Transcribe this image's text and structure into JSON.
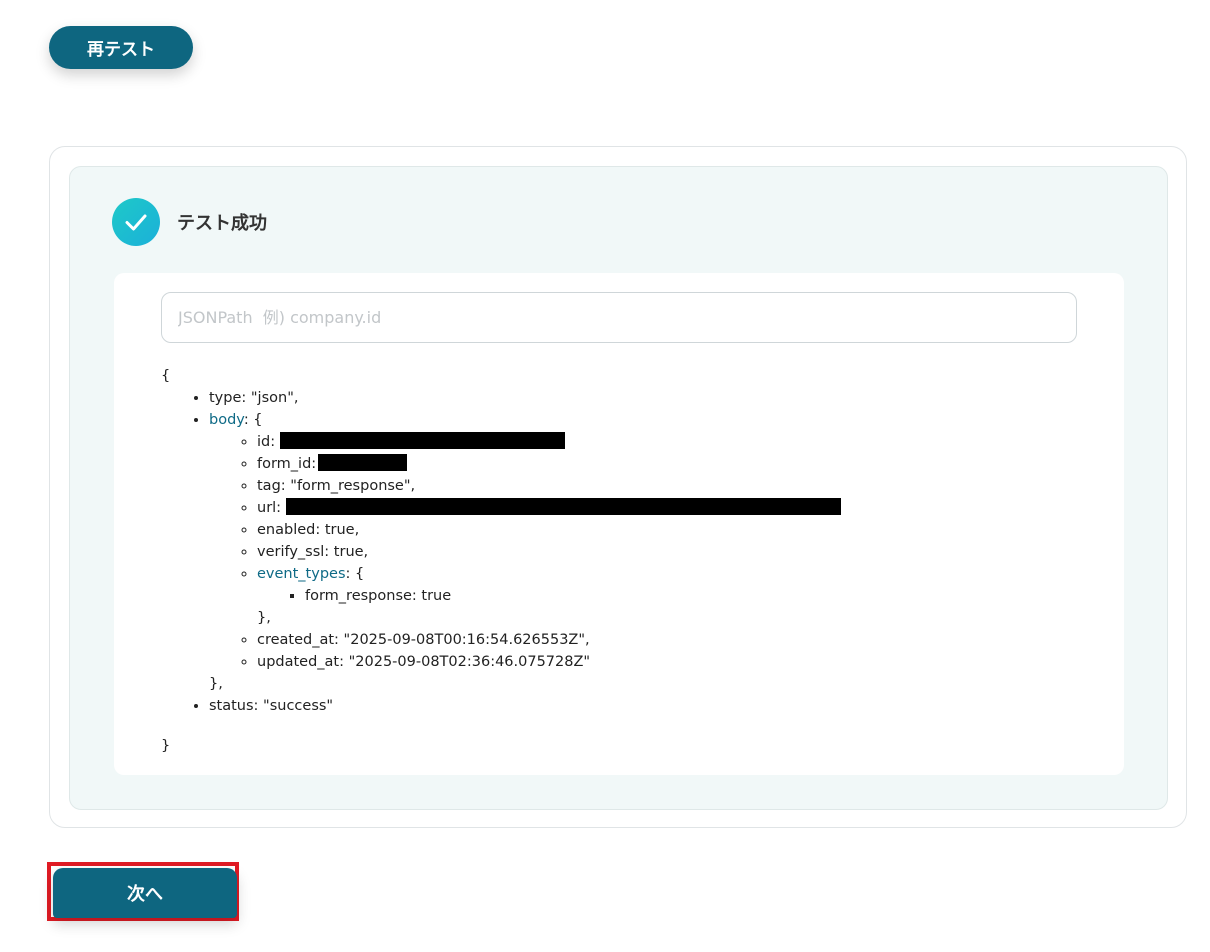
{
  "toolbar": {
    "retest_label": "再テスト"
  },
  "result": {
    "status_title": "テスト成功",
    "jsonpath_placeholder": "JSONPath  例) company.id",
    "json": {
      "open_brace": "{",
      "type_line": "type: \"json\",",
      "body_key": "body",
      "body_open": ": {",
      "id_label": "id:",
      "form_id_label": "form_id:",
      "tag_line": "tag: \"form_response\",",
      "url_label": "url:",
      "enabled_line": "enabled: true,",
      "verify_ssl_line": "verify_ssl: true,",
      "event_types_key": "event_types",
      "event_types_open": ": {",
      "form_response_line": "form_response: true",
      "event_types_close": "},",
      "created_at_line": "created_at: \"2025-09-08T00:16:54.626553Z\",",
      "updated_at_line": "updated_at: \"2025-09-08T02:36:46.075728Z\"",
      "body_close": "},",
      "status_line": "status: \"success\"",
      "close_brace": "}"
    }
  },
  "footer": {
    "next_label": "次へ"
  },
  "colors": {
    "primary": "#0e6680",
    "link": "#0e6a86",
    "highlight": "#e01b24"
  }
}
